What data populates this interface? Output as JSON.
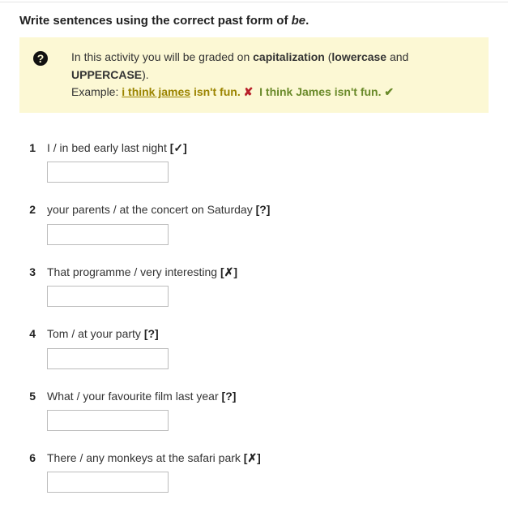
{
  "title_prefix": "Write sentences using the correct past form of ",
  "title_be": "be",
  "title_suffix": ".",
  "hint": {
    "line1_pre": "In this activity you will be graded on ",
    "cap": "capitalization",
    "paren_open": " (",
    "lower": "lowercase",
    "and": " and ",
    "upper": "UPPERCASE",
    "paren_close": ").",
    "line2_pre": "Example: ",
    "wrong": "i think james",
    "wrong_tail": " isn't fun.",
    "x": "✘",
    "right": "I think James isn't fun.",
    "check": "✔"
  },
  "questions": [
    {
      "n": "1",
      "prompt": "I / in bed early last night ",
      "mark": "[✓]",
      "value": ""
    },
    {
      "n": "2",
      "prompt": "your parents / at the concert on Saturday ",
      "mark": "[?]",
      "value": ""
    },
    {
      "n": "3",
      "prompt": "That programme / very interesting ",
      "mark": "[✗]",
      "value": ""
    },
    {
      "n": "4",
      "prompt": "Tom / at your party ",
      "mark": "[?]",
      "value": ""
    },
    {
      "n": "5",
      "prompt": "What / your favourite film last year ",
      "mark": "[?]",
      "value": ""
    },
    {
      "n": "6",
      "prompt": "There / any monkeys at the safari park ",
      "mark": "[✗]",
      "value": ""
    }
  ]
}
